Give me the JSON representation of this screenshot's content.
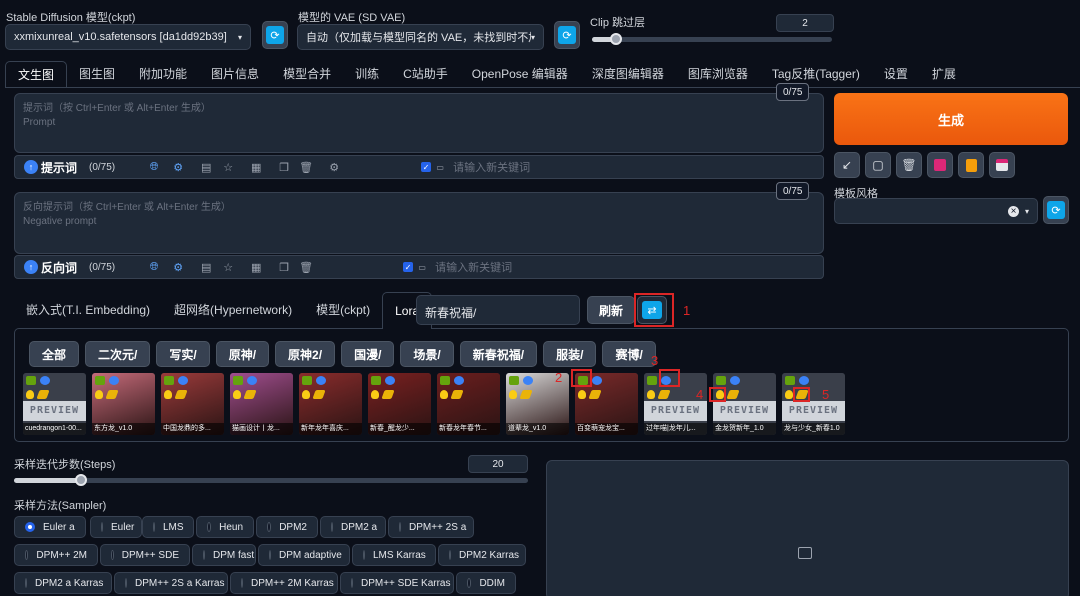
{
  "top": {
    "model_label": "Stable Diffusion 模型(ckpt)",
    "model_value": "xxmixunreal_v10.safetensors [da1dd92b39]",
    "vae_label": "模型的 VAE (SD VAE)",
    "vae_value": "自动（仅加载与模型同名的 VAE，未找到时不加",
    "clip_label": "Clip 跳过层",
    "clip_value": "2",
    "clip_level": 0.1
  },
  "tabs": [
    "文生图",
    "图生图",
    "附加功能",
    "图片信息",
    "模型合并",
    "训练",
    "C站助手",
    "OpenPose 编辑器",
    "深度图编辑器",
    "图库浏览器",
    "Tag反推(Tagger)",
    "设置",
    "扩展"
  ],
  "prompt": {
    "placeholder_cn": "提示词（按 Ctrl+Enter 或 Alt+Enter 生成）",
    "placeholder_en": "Prompt",
    "counter": "0/75",
    "toolbar_label": "提示词",
    "toolbar_count": "(0/75)",
    "keyword_placeholder": "请输入新关键词"
  },
  "negative": {
    "placeholder_cn": "反向提示词（按 Ctrl+Enter 或 Alt+Enter 生成）",
    "placeholder_en": "Negative prompt",
    "counter": "0/75",
    "toolbar_label": "反向词",
    "toolbar_count": "(0/75)",
    "keyword_placeholder": "请输入新关键词"
  },
  "right": {
    "generate": "生成",
    "style_label": "模板风格",
    "clear": "×"
  },
  "network_tabs": [
    "嵌入式(T.I. Embedding)",
    "超网络(Hypernetwork)",
    "模型(ckpt)",
    "Lora"
  ],
  "search_value": "新春祝福/",
  "refresh": "刷新",
  "categories": [
    "全部",
    "二次元/",
    "写实/",
    "原神/",
    "原神2/",
    "国漫/",
    "场景/",
    "新春祝福/",
    "服装/",
    "赛博/"
  ],
  "cards": [
    {
      "name": "cuedrangon1-00...",
      "preview": true
    },
    {
      "name": "东方龙_v1.0",
      "preview": false
    },
    {
      "name": "中国龙鼎的多...",
      "preview": false
    },
    {
      "name": "猫画设计丨龙...",
      "preview": false
    },
    {
      "name": "新年龙年喜庆...",
      "preview": false
    },
    {
      "name": "新春_醒龙少...",
      "preview": false
    },
    {
      "name": "新春龙年春节...",
      "preview": false
    },
    {
      "name": "道辈龙_v1.0",
      "preview": false
    },
    {
      "name": "百变萌宠龙宝...",
      "preview": false
    },
    {
      "name": "过年喵|龙年儿...",
      "preview": true
    },
    {
      "name": "金龙贺新年_1.0",
      "preview": true
    },
    {
      "name": "龙与少女_新春1.0",
      "preview": true
    }
  ],
  "preview_text": "PREVIEW",
  "annotations": [
    "1",
    "2",
    "3",
    "4",
    "5"
  ],
  "steps": {
    "label": "采样迭代步数(Steps)",
    "value": "20",
    "level": 0.13
  },
  "sampler": {
    "label": "采样方法(Sampler)",
    "options": [
      "Euler a",
      "Euler",
      "LMS",
      "Heun",
      "DPM2",
      "DPM2 a",
      "DPM++ 2S a",
      "DPM++ 2M",
      "DPM++ SDE",
      "DPM fast",
      "DPM adaptive",
      "LMS Karras",
      "DPM2 Karras",
      "DPM2 a Karras",
      "DPM++ 2S a Karras",
      "DPM++ 2M Karras",
      "DPM++ SDE Karras",
      "DDIM"
    ],
    "selected": "Euler a"
  }
}
